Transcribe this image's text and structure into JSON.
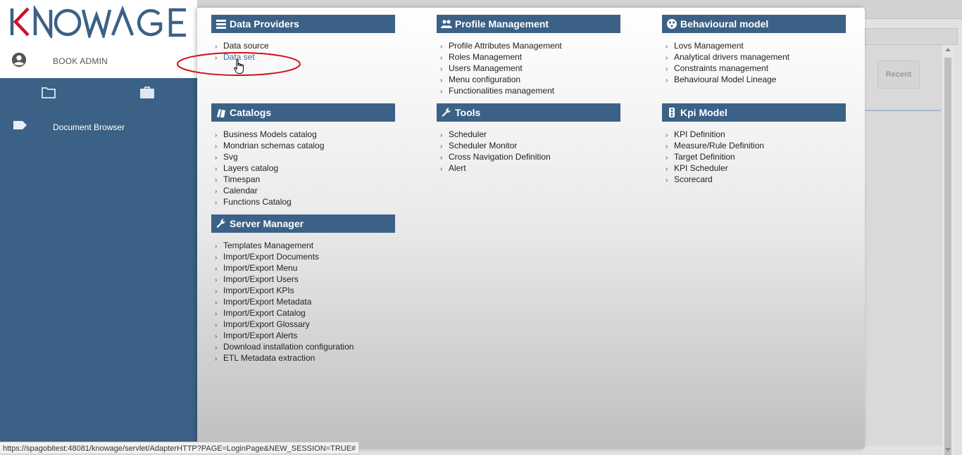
{
  "app": {
    "logo_text": "KNOWAGE",
    "user_name": "BOOK ADMIN",
    "nav_item": "Document Browser"
  },
  "background": {
    "recent_label": "Recent"
  },
  "sections": {
    "data_providers": {
      "title": "Data Providers",
      "icon": "list-icon",
      "items": [
        "Data source",
        "Data set"
      ]
    },
    "profile_management": {
      "title": "Profile Management",
      "icon": "people-icon",
      "items": [
        "Profile Attributes Management",
        "Roles Management",
        "Users Management",
        "Menu configuration",
        "Functionalities management"
      ]
    },
    "behavioural_model": {
      "title": "Behavioural model",
      "icon": "model-icon",
      "items": [
        "Lovs Management",
        "Analytical drivers management",
        "Constraints management",
        "Behavioural Model Lineage"
      ]
    },
    "catalogs": {
      "title": "Catalogs",
      "icon": "books-icon",
      "items": [
        "Business Models catalog",
        "Mondrian schemas catalog",
        "Svg",
        "Layers catalog",
        "Timespan",
        "Calendar",
        "Functions Catalog"
      ]
    },
    "tools": {
      "title": "Tools",
      "icon": "wrench-icon",
      "items": [
        "Scheduler",
        "Scheduler Monitor",
        "Cross Navigation Definition",
        "Alert"
      ]
    },
    "kpi_model": {
      "title": "Kpi Model",
      "icon": "traffic-light-icon",
      "items": [
        "KPI Definition",
        "Measure/Rule Definition",
        "Target Definition",
        "KPI Scheduler",
        "Scorecard"
      ]
    },
    "server_manager": {
      "title": "Server Manager",
      "icon": "wrench-icon",
      "items": [
        "Templates Management",
        "Import/Export Documents",
        "Import/Export Menu",
        "Import/Export Users",
        "Import/Export KPIs",
        "Import/Export Metadata",
        "Import/Export Catalog",
        "Import/Export Glossary",
        "Import/Export Alerts",
        "Download installation configuration",
        "ETL Metadata extraction"
      ]
    }
  },
  "status_url": "https://spagobitest:48081/knowage/servlet/AdapterHTTP?PAGE=LoginPage&NEW_SESSION=TRUE#",
  "colors": {
    "brand_blue": "#3b6187",
    "logo_red": "#c8102e",
    "highlight_red": "#d0101a",
    "active_link": "#3b6ca0"
  }
}
